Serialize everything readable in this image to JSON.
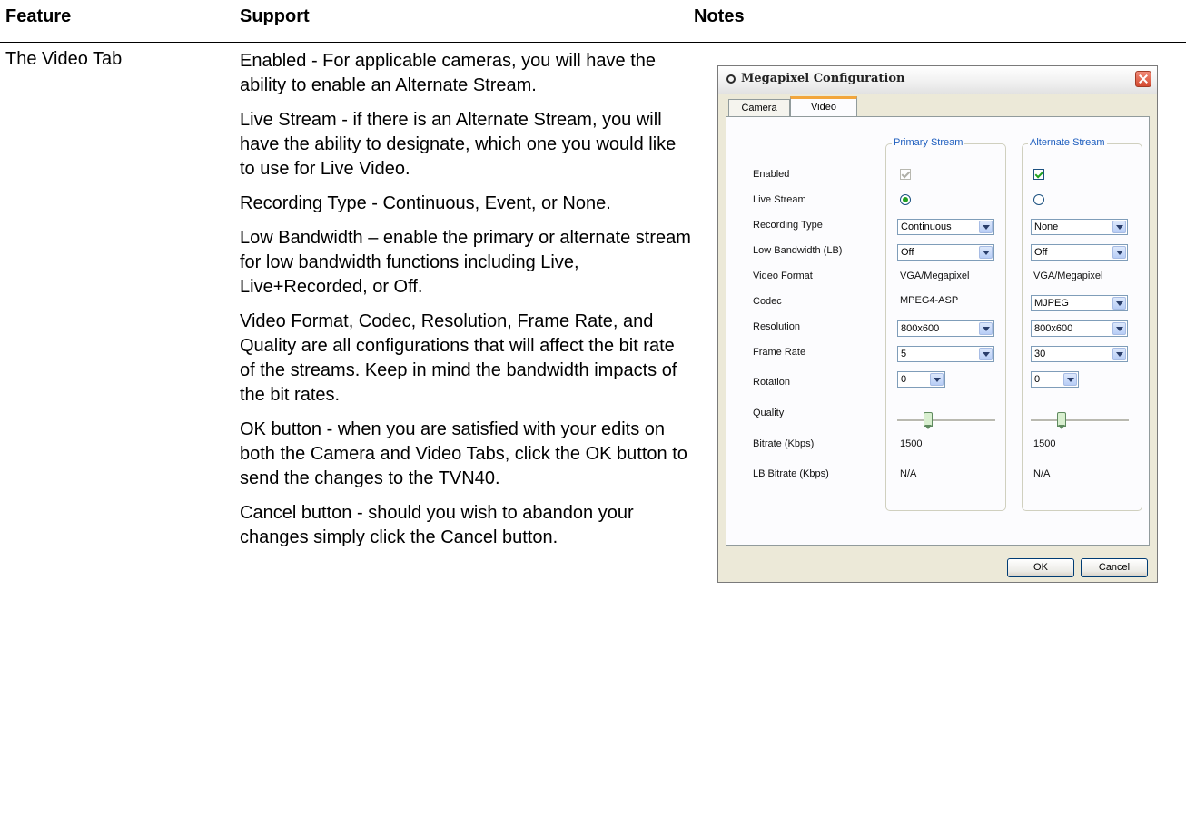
{
  "table": {
    "headers": {
      "feature": "Feature",
      "support": "Support",
      "notes": "Notes"
    },
    "feature": "The Video Tab",
    "support_paragraphs": [
      "Enabled - For applicable cameras, you will have the ability to enable an Alternate Stream.",
      "Live Stream - if there is an Alternate Stream, you will have the ability to designate, which one you would like to use for Live Video.",
      "Recording Type - Continuous, Event, or None.",
      "Low Bandwidth – enable the primary or alternate stream for low bandwidth functions including Live, Live+Recorded, or Off.",
      "Video Format, Codec, Resolution, Frame Rate, and Quality are all configurations that will affect the bit rate of the streams. Keep in mind the bandwidth impacts of the bit rates.",
      "OK button - when you are satisfied with your edits on both the Camera and Video Tabs, click the OK button to send the changes to the TVN40.",
      "Cancel button - should you wish to abandon your changes simply click the Cancel button."
    ]
  },
  "dialog": {
    "title": "Megapixel Configuration",
    "tabs": {
      "camera": "Camera",
      "video": "Video"
    },
    "groups": {
      "primary": "Primary Stream",
      "alternate": "Alternate Stream"
    },
    "row_labels": {
      "enabled": "Enabled",
      "live_stream": "Live Stream",
      "recording_type": "Recording Type",
      "low_bandwidth": "Low Bandwidth (LB)",
      "video_format": "Video Format",
      "codec": "Codec",
      "resolution": "Resolution",
      "frame_rate": "Frame Rate",
      "rotation": "Rotation",
      "quality": "Quality",
      "bitrate": "Bitrate (Kbps)",
      "lb_bitrate": "LB Bitrate (Kbps)"
    },
    "primary": {
      "enabled": true,
      "live_stream": true,
      "recording_type": "Continuous",
      "low_bandwidth": "Off",
      "video_format": "VGA/Megapixel",
      "codec": "MPEG4-ASP",
      "resolution": "800x600",
      "frame_rate": "5",
      "rotation": "0",
      "quality_level": 0.3,
      "bitrate": "1500",
      "lb_bitrate": "N/A"
    },
    "alternate": {
      "enabled": true,
      "live_stream": false,
      "recording_type": "None",
      "low_bandwidth": "Off",
      "video_format": "VGA/Megapixel",
      "codec": "MJPEG",
      "resolution": "800x600",
      "frame_rate": "30",
      "rotation": "0",
      "quality_level": 0.3,
      "bitrate": "1500",
      "lb_bitrate": "N/A"
    },
    "buttons": {
      "ok": "OK",
      "cancel": "Cancel"
    },
    "colors": {
      "group_title": "#1f5fbf",
      "tab_accent": "#f2a63c",
      "check": "#21a121"
    }
  }
}
